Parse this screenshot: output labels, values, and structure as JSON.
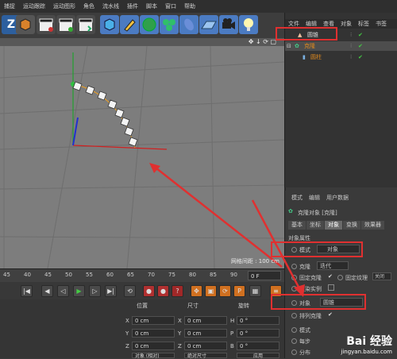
{
  "menu": [
    "捕捉",
    "运动跟踪",
    "运动图形",
    "角色",
    "流水线",
    "插件",
    "脚本",
    "窗口",
    "帮助"
  ],
  "toolbar_icons": [
    "z-tool-icon",
    "cube-icon",
    "clapper-icon",
    "clapper-icon",
    "clapper-icon",
    "cube-primitive-icon",
    "pen-icon",
    "subdivision-icon",
    "cloner-icon",
    "deformer-icon",
    "floor-icon",
    "camera-icon",
    "light-icon"
  ],
  "viewport": {
    "status": "网格间距 : 100 cm",
    "nav_icons": "✥ ↓ ⟳ ▢"
  },
  "timeline": {
    "ticks": [
      "45",
      "40",
      "45",
      "50",
      "55",
      "60",
      "65",
      "70",
      "75",
      "80",
      "85",
      "90"
    ],
    "frame": "0 F"
  },
  "coord": {
    "headers": [
      "位置",
      "尺寸",
      "旋转"
    ],
    "rows": [
      {
        "axis": "X",
        "pos": "0 cm",
        "size_axis": "X",
        "size": "0 cm",
        "rot_axis": "H",
        "rot": "0 °"
      },
      {
        "axis": "Y",
        "pos": "0 cm",
        "size_axis": "Y",
        "size": "0 cm",
        "rot_axis": "P",
        "rot": "0 °"
      },
      {
        "axis": "Z",
        "pos": "0 cm",
        "size_axis": "Z",
        "size": "0 cm",
        "rot_axis": "B",
        "rot": "0 °"
      }
    ],
    "mode_select": "对象 (相对)",
    "size_select": "绝对尺寸",
    "apply": "应用"
  },
  "object_manager": {
    "tabs": [
      "文件",
      "编辑",
      "查看",
      "对象",
      "标签",
      "书签"
    ],
    "objects": [
      {
        "name": "圆锥",
        "level": 0
      },
      {
        "name": "克隆",
        "level": 0
      },
      {
        "name": "圆柱",
        "level": 1
      }
    ]
  },
  "attribute_manager": {
    "tabs": [
      "模式",
      "编辑",
      "用户数据"
    ],
    "object_title": "克隆对象 [克隆]",
    "subtabs": [
      "基本",
      "坐标",
      "对象",
      "变换",
      "效果器"
    ],
    "section": "对象属性",
    "mode_label": "模式",
    "mode_value": "对象",
    "clone_label": "克隆",
    "clone_value": "迭代",
    "fix_clone": "固定克隆",
    "fix_texture": "固定纹理",
    "fix_texture_value": "关闭",
    "render_instance": "渲染实例",
    "object_label": "对象",
    "object_value": "圆锥",
    "arrange_clone": "排列克隆",
    "more": [
      "模式",
      "每步",
      "分布"
    ]
  },
  "watermark": {
    "brand": "Bai 经验",
    "url": "jingyan.baidu.com"
  },
  "colors": {
    "highlight": "#e03030",
    "viewport_bg": "#7d7d7d",
    "accent_orange": "#e08a1e"
  }
}
